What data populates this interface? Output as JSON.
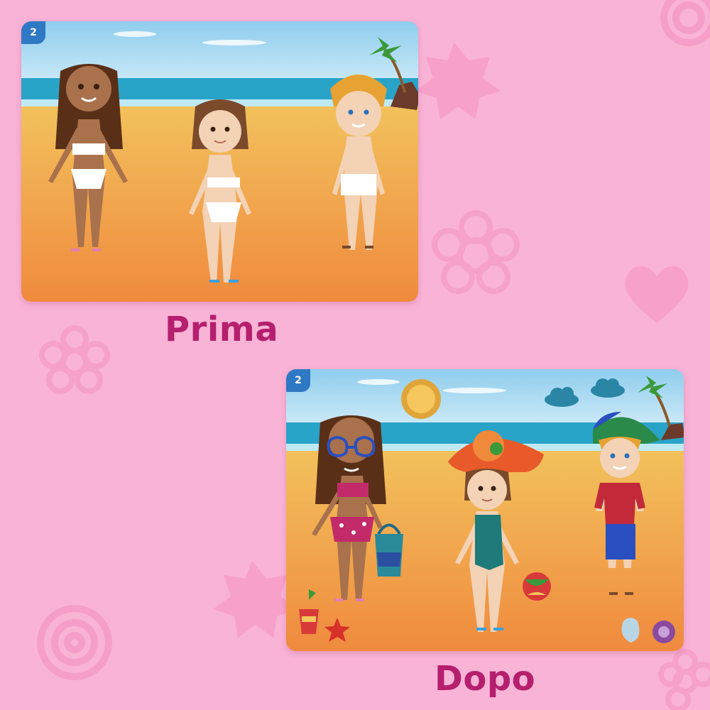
{
  "before": {
    "page_number": "2",
    "caption": "Prima"
  },
  "after": {
    "page_number": "2",
    "caption": "Dopo"
  },
  "colors": {
    "background": "#f9b3d6",
    "caption": "#b51f6e",
    "badge": "#2f78c4",
    "sky": "#9fd6ef",
    "sea": "#2aa3c9",
    "sand": "#f0a64a"
  }
}
